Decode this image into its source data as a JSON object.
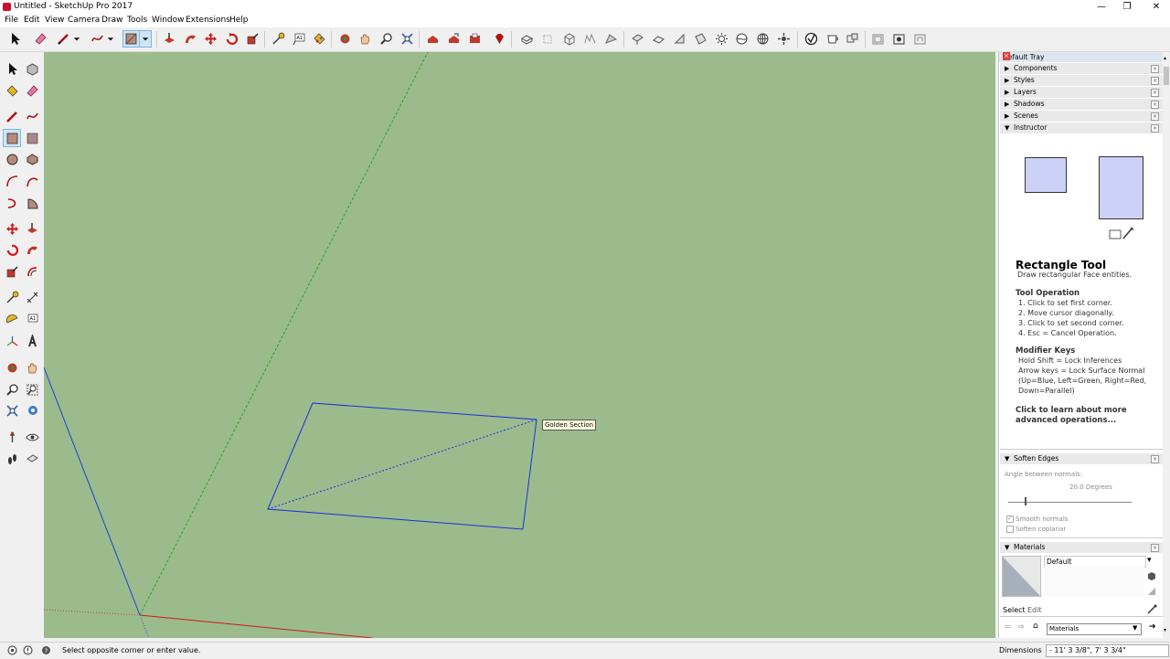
{
  "window": {
    "title": "Untitled - SketchUp Pro 2017",
    "controls": [
      "—",
      "❐",
      "✕"
    ]
  },
  "menu": [
    "File",
    "Edit",
    "View",
    "Camera",
    "Draw",
    "Tools",
    "Window",
    "Extensions",
    "Help"
  ],
  "viewport": {
    "background": "#9bbb8d",
    "tooltip": "Golden Section"
  },
  "tray": {
    "title": "Default Tray",
    "panels": [
      "Components",
      "Styles",
      "Layers",
      "Shadows",
      "Scenes",
      "Instructor"
    ],
    "instructor": {
      "title": "Rectangle Tool",
      "subtitle": "Draw rectangular Face entities.",
      "operation_heading": "Tool Operation",
      "operation_steps": [
        "1. Click to set first corner.",
        "2. Move cursor diagonally.",
        "3. Click to set second corner.",
        "4. Esc = Cancel Operation."
      ],
      "modifier_heading": "Modifier Keys",
      "modifier_lines": [
        "Hold Shift = Lock Inferences",
        "Arrow keys = Lock Surface Normal",
        "(Up=Blue, Left=Green, Right=Red,",
        "Down=Parallel)"
      ],
      "link_lines": [
        "Click to learn about more",
        "advanced operations..."
      ]
    },
    "soften": {
      "title": "Soften Edges",
      "angle_label": "Angle between normals:",
      "angle_value": "20.0  Degrees",
      "smooth_label": "Smooth normals",
      "coplanar_label": "Soften coplanar"
    },
    "materials": {
      "title": "Materials",
      "name": "Default",
      "tab_select": "Select",
      "tab_edit": "Edit",
      "library": "Materials"
    }
  },
  "status": {
    "message": "Select opposite corner or enter value.",
    "dimensions_label": "Dimensions",
    "dimensions_value": "- 11' 3 3/8\", 7' 3 3/4\""
  }
}
